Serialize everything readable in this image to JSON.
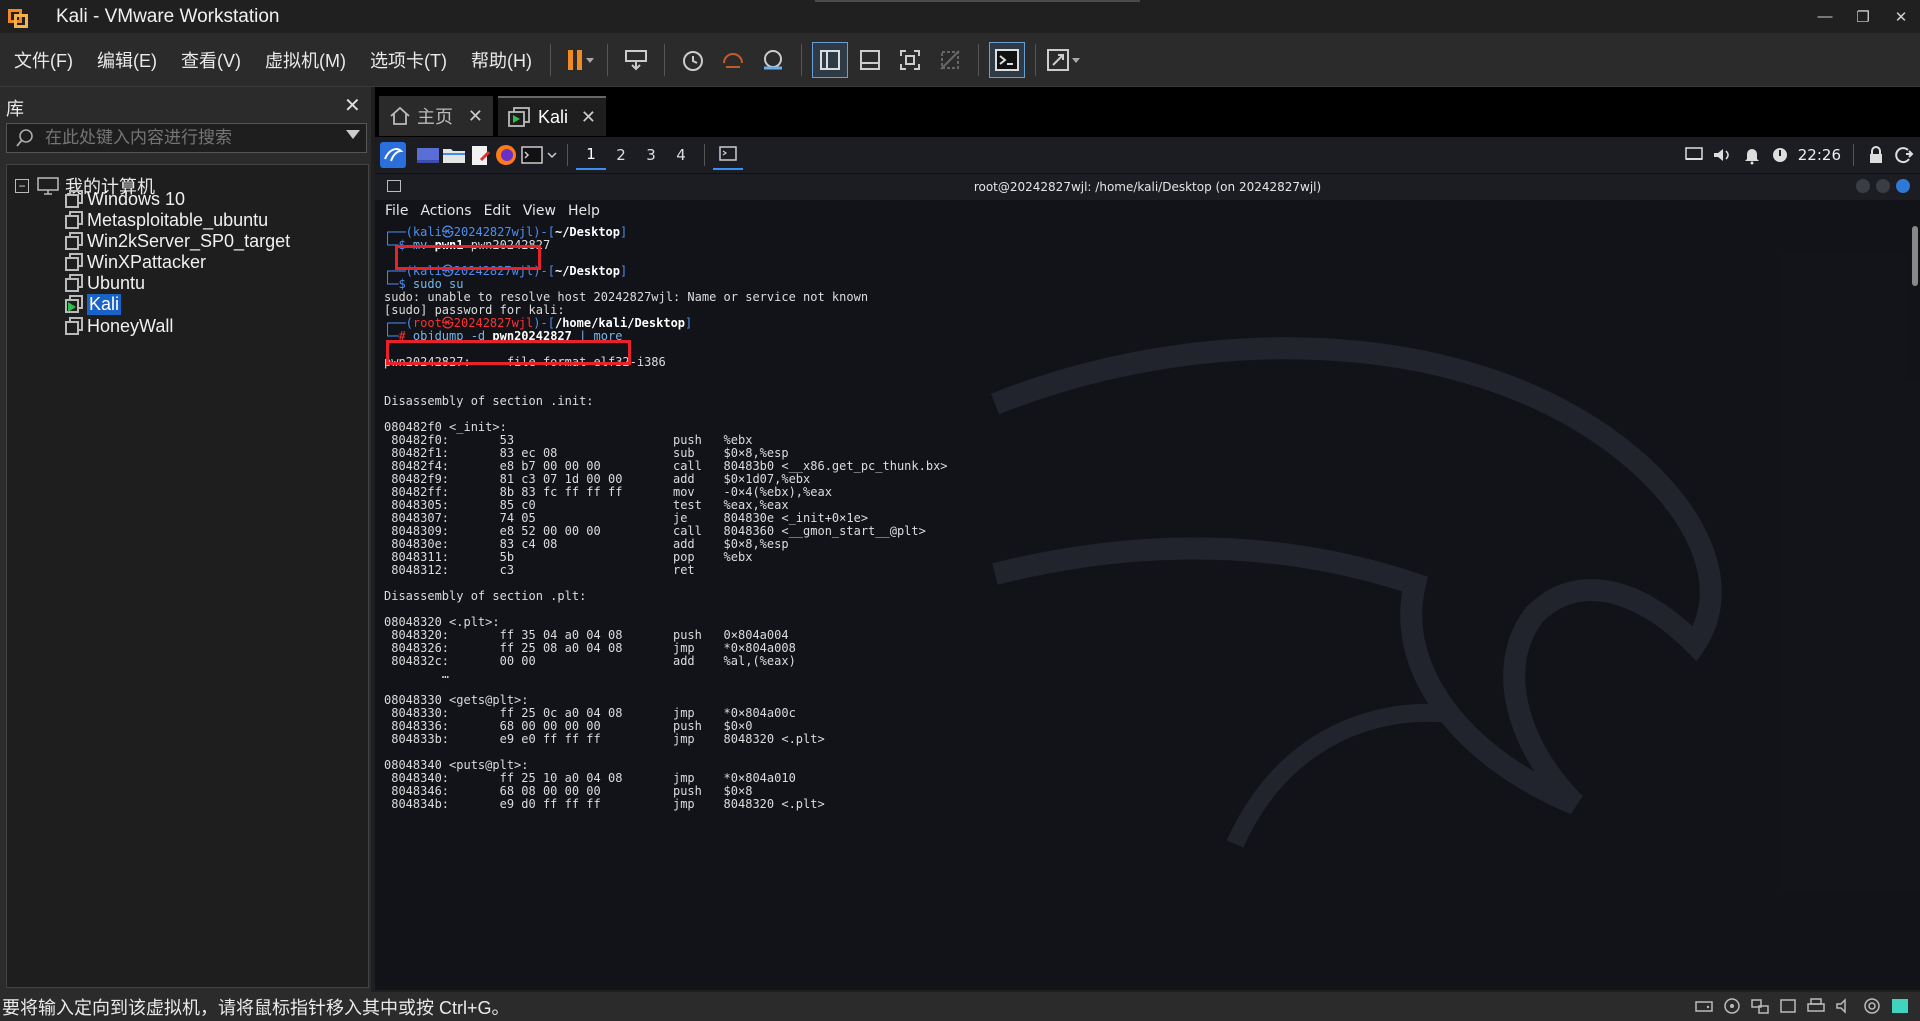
{
  "window": {
    "title": "Kali - VMware Workstation"
  },
  "menu": [
    "文件(F)",
    "编辑(E)",
    "查看(V)",
    "虚拟机(M)",
    "选项卡(T)",
    "帮助(H)"
  ],
  "library": {
    "title": "库",
    "search_placeholder": "在此处键入内容进行搜索",
    "root_label": "我的计算机",
    "vms": [
      {
        "name": "Windows 10",
        "running": false,
        "selected": false
      },
      {
        "name": "Metasploitable_ubuntu",
        "running": false,
        "selected": false
      },
      {
        "name": "Win2kServer_SP0_target",
        "running": false,
        "selected": false
      },
      {
        "name": "WinXPattacker",
        "running": false,
        "selected": false
      },
      {
        "name": "Ubuntu",
        "running": false,
        "selected": false
      },
      {
        "name": "Kali",
        "running": true,
        "selected": true
      },
      {
        "name": "HoneyWall",
        "running": false,
        "selected": false
      }
    ]
  },
  "tabs": [
    {
      "label": "主页"
    },
    {
      "label": "Kali"
    }
  ],
  "guest_panel": {
    "workspaces": [
      "1",
      "2",
      "3",
      "4"
    ],
    "active_workspace": "1",
    "clock": "22:26"
  },
  "terminal": {
    "title": "root@20242827wjl: /home/kali/Desktop (on 20242827wjl)",
    "menu": [
      "File",
      "Actions",
      "Edit",
      "View",
      "Help"
    ],
    "lines": [
      [
        {
          "t": "┌──(",
          "c": "blue"
        },
        {
          "t": "kali㉿20242827wjl",
          "c": "blue"
        },
        {
          "t": ")-[",
          "c": "blue"
        },
        {
          "t": "~/Desktop",
          "c": "white-b"
        },
        {
          "t": "]",
          "c": "blue"
        }
      ],
      [
        {
          "t": "└─",
          "c": "blue"
        },
        {
          "t": "$ ",
          "c": "blue"
        },
        {
          "t": "mv ",
          "c": "cyan"
        },
        {
          "t": "pwn1",
          "c": "white-b"
        },
        {
          "t": " pwn20242827",
          "c": "plain"
        }
      ],
      [],
      [
        {
          "t": "┌──(",
          "c": "blue"
        },
        {
          "t": "kali㉿20242827wjl",
          "c": "blue"
        },
        {
          "t": ")-[",
          "c": "blue"
        },
        {
          "t": "~/Desktop",
          "c": "white-b"
        },
        {
          "t": "]",
          "c": "blue"
        }
      ],
      [
        {
          "t": "└─",
          "c": "blue"
        },
        {
          "t": "$ ",
          "c": "blue"
        },
        {
          "t": "sudo su",
          "c": "cyan"
        }
      ],
      [
        {
          "t": "sudo: unable to resolve host 20242827wjl: Name or service not known",
          "c": "plain"
        }
      ],
      [
        {
          "t": "[sudo] password for kali:",
          "c": "plain"
        }
      ],
      [
        {
          "t": "┌──(",
          "c": "blue"
        },
        {
          "t": "root㉿20242827wjl",
          "c": "red"
        },
        {
          "t": ")-[",
          "c": "blue"
        },
        {
          "t": "/home/kali/Desktop",
          "c": "white-b"
        },
        {
          "t": "]",
          "c": "blue"
        }
      ],
      [
        {
          "t": "└─",
          "c": "blue"
        },
        {
          "t": "# ",
          "c": "red"
        },
        {
          "t": "objdump -d ",
          "c": "cyan"
        },
        {
          "t": "pwn20242827",
          "c": "white-b"
        },
        {
          "t": " | more",
          "c": "cyan"
        }
      ],
      [],
      [
        {
          "t": "pwn20242827:     file format elf32-i386",
          "c": "plain"
        }
      ],
      [],
      [],
      [
        {
          "t": "Disassembly of section .init:",
          "c": "plain"
        }
      ],
      [],
      [
        {
          "t": "080482f0 <_init>:",
          "c": "plain"
        }
      ],
      [
        {
          "t": " 80482f0:       53                      push   %ebx",
          "c": "plain"
        }
      ],
      [
        {
          "t": " 80482f1:       83 ec 08                sub    $0×8,%esp",
          "c": "plain"
        }
      ],
      [
        {
          "t": " 80482f4:       e8 b7 00 00 00          call   80483b0 <__x86.get_pc_thunk.bx>",
          "c": "plain"
        }
      ],
      [
        {
          "t": " 80482f9:       81 c3 07 1d 00 00       add    $0×1d07,%ebx",
          "c": "plain"
        }
      ],
      [
        {
          "t": " 80482ff:       8b 83 fc ff ff ff       mov    -0×4(%ebx),%eax",
          "c": "plain"
        }
      ],
      [
        {
          "t": " 8048305:       85 c0                   test   %eax,%eax",
          "c": "plain"
        }
      ],
      [
        {
          "t": " 8048307:       74 05                   je     804830e <_init+0×1e>",
          "c": "plain"
        }
      ],
      [
        {
          "t": " 8048309:       e8 52 00 00 00          call   8048360 <__gmon_start__@plt>",
          "c": "plain"
        }
      ],
      [
        {
          "t": " 804830e:       83 c4 08                add    $0×8,%esp",
          "c": "plain"
        }
      ],
      [
        {
          "t": " 8048311:       5b                      pop    %ebx",
          "c": "plain"
        }
      ],
      [
        {
          "t": " 8048312:       c3                      ret",
          "c": "plain"
        }
      ],
      [],
      [
        {
          "t": "Disassembly of section .plt:",
          "c": "plain"
        }
      ],
      [],
      [
        {
          "t": "08048320 <.plt>:",
          "c": "plain"
        }
      ],
      [
        {
          "t": " 8048320:       ff 35 04 a0 04 08       push   0×804a004",
          "c": "plain"
        }
      ],
      [
        {
          "t": " 8048326:       ff 25 08 a0 04 08       jmp    *0×804a008",
          "c": "plain"
        }
      ],
      [
        {
          "t": " 804832c:       00 00                   add    %al,(%eax)",
          "c": "plain"
        }
      ],
      [
        {
          "t": "        …",
          "c": "plain"
        }
      ],
      [],
      [
        {
          "t": "08048330 <gets@plt>:",
          "c": "plain"
        }
      ],
      [
        {
          "t": " 8048330:       ff 25 0c a0 04 08       jmp    *0×804a00c",
          "c": "plain"
        }
      ],
      [
        {
          "t": " 8048336:       68 00 00 00 00          push   $0×0",
          "c": "plain"
        }
      ],
      [
        {
          "t": " 804833b:       e9 e0 ff ff ff          jmp    8048320 <.plt>",
          "c": "plain"
        }
      ],
      [],
      [
        {
          "t": "08048340 <puts@plt>:",
          "c": "plain"
        }
      ],
      [
        {
          "t": " 8048340:       ff 25 10 a0 04 08       jmp    *0×804a010",
          "c": "plain"
        }
      ],
      [
        {
          "t": " 8048346:       68 08 00 00 00          push   $0×8",
          "c": "plain"
        }
      ],
      [
        {
          "t": " 804834b:       e9 d0 ff ff ff          jmp    8048320 <.plt>",
          "c": "plain"
        }
      ]
    ]
  },
  "statusbar": {
    "text": "要将输入定向到该虚拟机，请将鼠标指针移入其中或按 Ctrl+G。"
  },
  "colors": {
    "accent_blue": "#1a63c6",
    "highlight_red": "#e8222a",
    "pause_orange": "#f08a24"
  }
}
